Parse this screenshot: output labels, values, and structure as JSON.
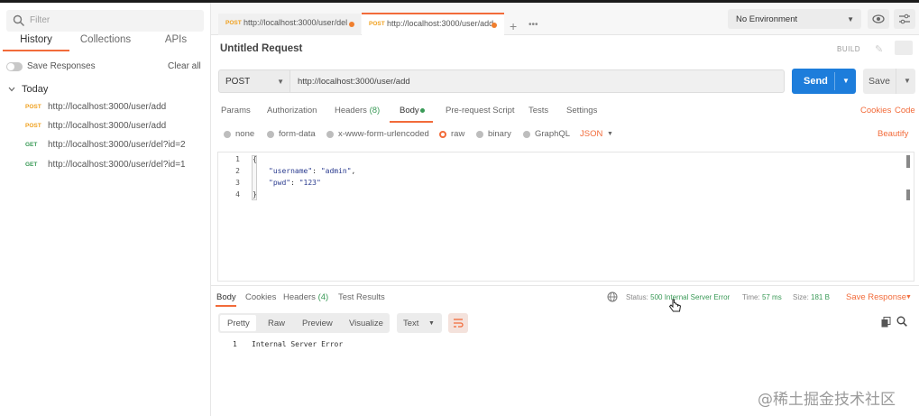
{
  "sidebar": {
    "search_placeholder": "Filter",
    "tabs": [
      "History",
      "Collections",
      "APIs"
    ],
    "save_responses": "Save Responses",
    "clear_all": "Clear all",
    "group": "Today",
    "history": [
      {
        "method": "POST",
        "url": "http://localhost:3000/user/add"
      },
      {
        "method": "POST",
        "url": "http://localhost:3000/user/add"
      },
      {
        "method": "GET",
        "url": "http://localhost:3000/user/del?id=2"
      },
      {
        "method": "GET",
        "url": "http://localhost:3000/user/del?id=1"
      }
    ]
  },
  "tabs": [
    {
      "method": "POST",
      "url": "http://localhost:3000/user/del"
    },
    {
      "method": "POST",
      "url": "http://localhost:3000/user/add"
    }
  ],
  "environment": "No Environment",
  "request": {
    "title": "Untitled Request",
    "build": "BUILD",
    "method": "POST",
    "url": "http://localhost:3000/user/add",
    "send": "Send",
    "save": "Save",
    "tabs": {
      "params": "Params",
      "authorization": "Authorization",
      "headers": "Headers",
      "headers_count": "(8)",
      "body": "Body",
      "prerequest": "Pre-request Script",
      "tests": "Tests",
      "settings": "Settings"
    },
    "cookies": "Cookies",
    "code": "Code",
    "body_types": [
      "none",
      "form-data",
      "x-www-form-urlencoded",
      "raw",
      "binary",
      "GraphQL"
    ],
    "body_format": "JSON",
    "beautify": "Beautify",
    "editor_lines": [
      "1",
      "2",
      "3",
      "4"
    ],
    "body_json": {
      "open": "{",
      "username_key": "\"username\"",
      "username_val": "\"admin\"",
      "pwd_key": "\"pwd\"",
      "pwd_val": "\"123\"",
      "close": "}"
    }
  },
  "response": {
    "tabs": {
      "body": "Body",
      "cookies": "Cookies",
      "headers": "Headers",
      "headers_count": "(4)",
      "test_results": "Test Results"
    },
    "status_label": "Status:",
    "status": "500 Internal Server Error",
    "time_label": "Time:",
    "time": "57 ms",
    "size_label": "Size:",
    "size": "181 B",
    "save_response": "Save Response",
    "formats": [
      "Pretty",
      "Raw",
      "Preview",
      "Visualize"
    ],
    "text_type": "Text",
    "line_no": "1",
    "body": "Internal Server Error"
  },
  "watermark": "@稀土掘金技术社区"
}
